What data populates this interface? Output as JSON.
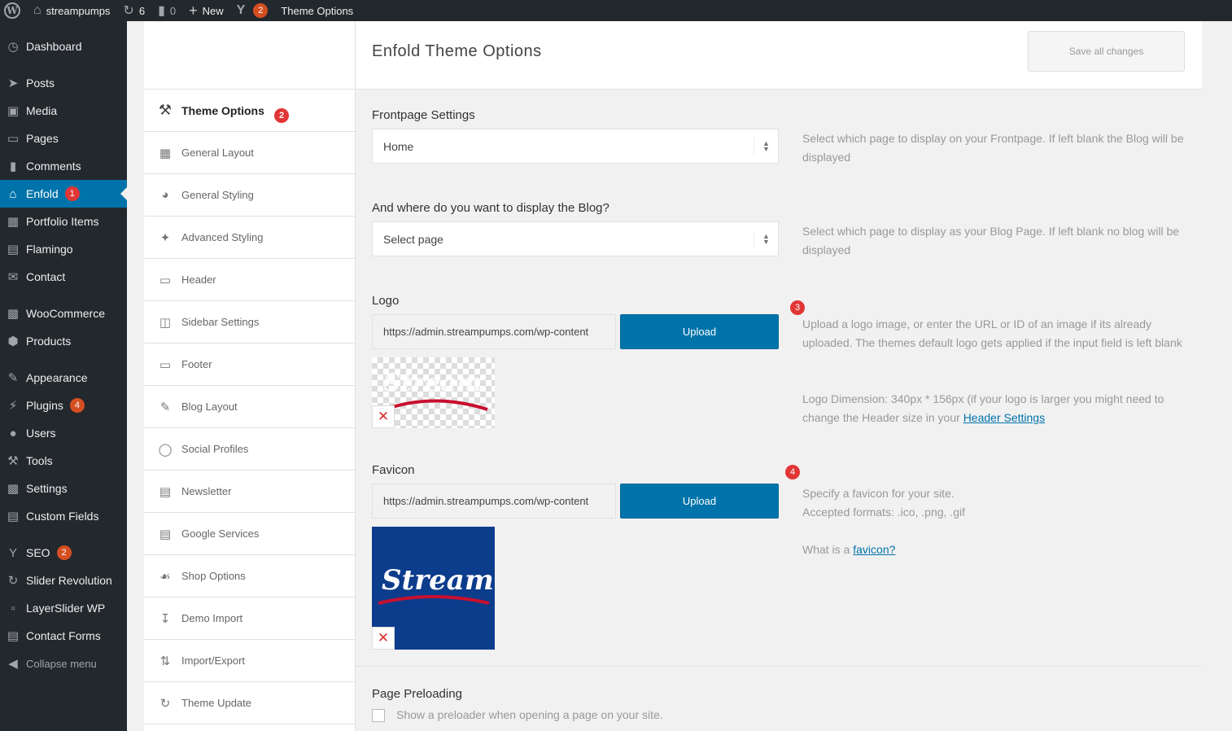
{
  "adminbar": {
    "site_name": "streampumps",
    "updates_count": "6",
    "comments_count": "0",
    "new_label": "New",
    "seo_count": "2",
    "page_label": "Theme Options"
  },
  "sidebar": {
    "items": [
      {
        "label": "Dashboard",
        "icon": "dashboard-icon"
      },
      {
        "label": "Posts",
        "icon": "pin-icon"
      },
      {
        "label": "Media",
        "icon": "media-icon"
      },
      {
        "label": "Pages",
        "icon": "pages-icon"
      },
      {
        "label": "Comments",
        "icon": "comment-icon"
      },
      {
        "label": "Enfold",
        "icon": "home-icon",
        "badge": "1"
      },
      {
        "label": "Portfolio Items",
        "icon": "portfolio-icon"
      },
      {
        "label": "Flamingo",
        "icon": "flamingo-icon"
      },
      {
        "label": "Contact",
        "icon": "mail-icon"
      },
      {
        "label": "WooCommerce",
        "icon": "woo-icon"
      },
      {
        "label": "Products",
        "icon": "box-icon"
      },
      {
        "label": "Appearance",
        "icon": "brush-icon"
      },
      {
        "label": "Plugins",
        "icon": "plug-icon",
        "badge": "4"
      },
      {
        "label": "Users",
        "icon": "user-icon"
      },
      {
        "label": "Tools",
        "icon": "wrench-icon"
      },
      {
        "label": "Settings",
        "icon": "settings-icon"
      },
      {
        "label": "Custom Fields",
        "icon": "fields-icon"
      },
      {
        "label": "SEO",
        "icon": "seo-icon",
        "badge": "2"
      },
      {
        "label": "Slider Revolution",
        "icon": "refresh-icon"
      },
      {
        "label": "LayerSlider WP",
        "icon": "layers-icon"
      },
      {
        "label": "Contact Forms",
        "icon": "forms-icon"
      },
      {
        "label": "Collapse menu",
        "icon": "collapse-icon"
      }
    ]
  },
  "options_nav": {
    "items": [
      {
        "label": "Theme Options",
        "icon": "tools-icon",
        "badge": "2"
      },
      {
        "label": "General Layout",
        "icon": "layout-icon"
      },
      {
        "label": "General Styling",
        "icon": "palette-icon"
      },
      {
        "label": "Advanced Styling",
        "icon": "magic-wand-icon"
      },
      {
        "label": "Header",
        "icon": "header-icon"
      },
      {
        "label": "Sidebar Settings",
        "icon": "sidebar-icon"
      },
      {
        "label": "Footer",
        "icon": "footer-icon"
      },
      {
        "label": "Blog Layout",
        "icon": "blog-icon"
      },
      {
        "label": "Social Profiles",
        "icon": "social-icon"
      },
      {
        "label": "Newsletter",
        "icon": "newsletter-icon"
      },
      {
        "label": "Google Services",
        "icon": "map-icon"
      },
      {
        "label": "Shop Options",
        "icon": "cart-icon"
      },
      {
        "label": "Demo Import",
        "icon": "import-icon"
      },
      {
        "label": "Import/Export",
        "icon": "export-icon"
      },
      {
        "label": "Theme Update",
        "icon": "update-icon"
      }
    ]
  },
  "header": {
    "title": "Enfold Theme Options",
    "save_label": "Save all changes"
  },
  "frontpage": {
    "title": "Frontpage Settings",
    "value": "Home",
    "desc": "Select which page to display on your Frontpage. If left blank the Blog will be displayed"
  },
  "blog": {
    "title": "And where do you want to display the Blog?",
    "value": "Select page",
    "desc": "Select which page to display as your Blog Page. If left blank no blog will be displayed"
  },
  "logo": {
    "title": "Logo",
    "url": "https://admin.streampumps.com/wp-content",
    "upload_label": "Upload",
    "badge": "3",
    "desc": "Upload a logo image, or enter the URL or ID of an image if its already uploaded. The themes default logo gets applied if the input field is left blank",
    "dimension_text": "Logo Dimension: 340px * 156px (if your logo is larger you might need to change the Header size in your",
    "dimension_link": "Header Settings",
    "preview_text": "Stream"
  },
  "favicon": {
    "title": "Favicon",
    "url": "https://admin.streampumps.com/wp-content",
    "upload_label": "Upload",
    "badge": "4",
    "desc_line1": "Specify a favicon for your site.",
    "desc_line2": "Accepted formats: .ico, .png, .gif",
    "what_text": "What is a",
    "what_link": "favicon?",
    "preview_text": "Stream"
  },
  "preloading": {
    "title": "Page Preloading",
    "checkbox_label": "Show a preloader when opening a page on your site."
  },
  "colors": {
    "admin_bg": "#23282d",
    "accent": "#0073aa",
    "badge_red": "#e23535",
    "brand_blue": "#0c3c8c"
  }
}
